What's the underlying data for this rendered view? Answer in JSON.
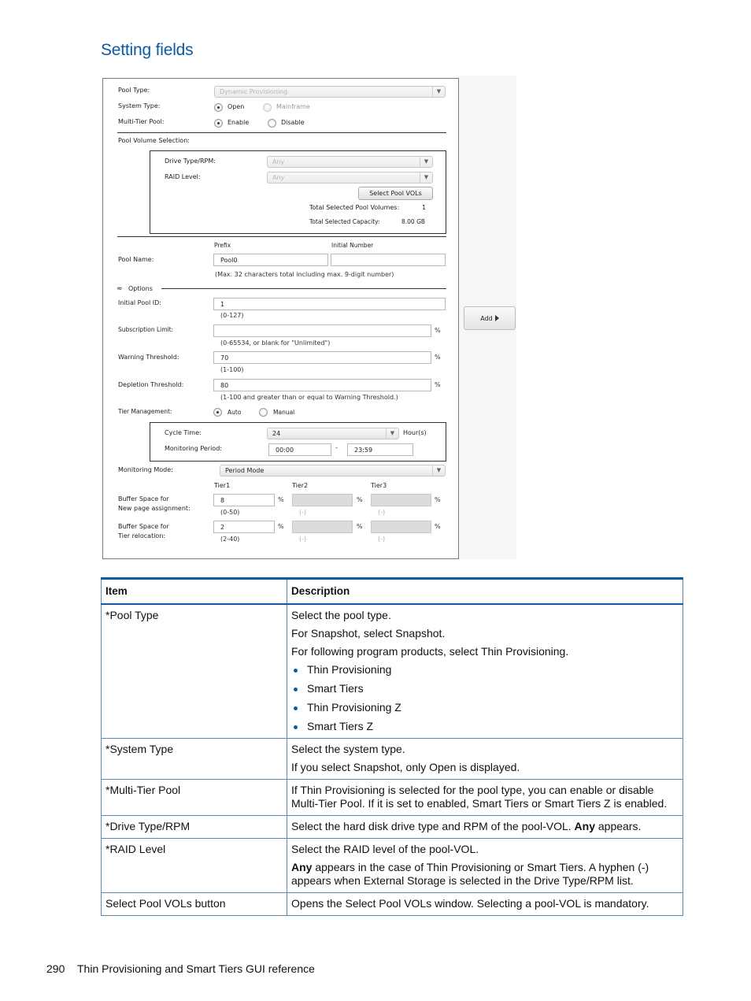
{
  "section_title": "Setting fields",
  "dialog": {
    "pool_type": {
      "label": "Pool Type:",
      "value": "Dynamic Provisioning"
    },
    "system_type": {
      "label": "System Type:",
      "options": [
        "Open",
        "Mainframe"
      ],
      "selected": "Open"
    },
    "multi_tier_pool": {
      "label": "Multi-Tier Pool:",
      "options": [
        "Enable",
        "Disable"
      ],
      "selected": "Enable"
    },
    "pool_volume_selection": {
      "label": "Pool Volume Selection:",
      "drive_type": {
        "label": "Drive Type/RPM:",
        "value": "Any"
      },
      "raid_level": {
        "label": "RAID Level:",
        "value": "Any"
      },
      "select_button": "Select Pool VOLs",
      "total_volumes_label": "Total Selected Pool Volumes:",
      "total_volumes_value": "1",
      "total_capacity_label": "Total Selected Capacity:",
      "total_capacity_value": "8.00 GB"
    },
    "pool_name": {
      "label": "Pool Name:",
      "prefix_header": "Prefix",
      "initial_number_header": "Initial Number",
      "prefix_value": "Pool0",
      "initial_number_value": "",
      "hint": "(Max. 32 characters total including max. 9-digit number)"
    },
    "options_label": "Options",
    "initial_pool_id": {
      "label": "Initial Pool ID:",
      "value": "1",
      "hint": "(0-127)"
    },
    "subscription_limit": {
      "label": "Subscription Limit:",
      "value": "",
      "unit": "%",
      "hint": "(0-65534, or blank for \"Unlimited\")"
    },
    "warning_threshold": {
      "label": "Warning Threshold:",
      "value": "70",
      "unit": "%",
      "hint": "(1-100)"
    },
    "depletion_threshold": {
      "label": "Depletion Threshold:",
      "value": "80",
      "unit": "%",
      "hint": "(1-100 and greater than or equal to Warning Threshold.)"
    },
    "tier_management": {
      "label": "Tier Management:",
      "options": [
        "Auto",
        "Manual"
      ],
      "selected": "Auto"
    },
    "cycle_time": {
      "label": "Cycle Time:",
      "value": "24",
      "unit": "Hour(s)"
    },
    "monitoring_period": {
      "label": "Monitoring Period:",
      "start": "00:00",
      "separator": "-",
      "end": "23:59"
    },
    "monitoring_mode": {
      "label": "Monitoring Mode:",
      "value": "Period Mode"
    },
    "tiers": {
      "headers": [
        "Tier1",
        "Tier2",
        "Tier3"
      ],
      "buffer_new_page": {
        "label_line1": "Buffer Space for",
        "label_line2": "New page assignment:",
        "values": [
          "8",
          "",
          ""
        ],
        "hints": [
          "(0-50)",
          "(-)",
          "(-)"
        ],
        "unit": "%"
      },
      "buffer_relocation": {
        "label_line1": "Buffer Space for",
        "label_line2": "Tier relocation:",
        "values": [
          "2",
          "",
          ""
        ],
        "hints": [
          "(2-40)",
          "(-)",
          "(-)"
        ],
        "unit": "%"
      }
    },
    "add_button": "Add"
  },
  "table": {
    "headers": [
      "Item",
      "Description"
    ],
    "rows": [
      {
        "item": "*Pool Type",
        "desc": [
          "Select the pool type.",
          "For Snapshot, select Snapshot.",
          "For following program products, select Thin Provisioning."
        ],
        "bullets": [
          "Thin Provisioning",
          "Smart Tiers",
          "Thin Provisioning Z",
          "Smart Tiers Z"
        ]
      },
      {
        "item": "*System Type",
        "desc": [
          "Select the system type.",
          "If you select Snapshot, only Open is displayed."
        ]
      },
      {
        "item": "*Multi-Tier Pool",
        "desc": [
          "If Thin Provisioning is selected for the pool type, you can enable or disable Multi-Tier Pool. If it is set to enabled, Smart Tiers or Smart Tiers Z is enabled."
        ]
      },
      {
        "item": "*Drive Type/RPM",
        "desc_pre": "Select the hard disk drive type and RPM of the pool-VOL. ",
        "desc_bold": "Any",
        "desc_post": " appears."
      },
      {
        "item": "*RAID Level",
        "desc": [
          "Select the RAID level of the pool-VOL."
        ],
        "desc2_bold": "Any",
        "desc2_post": " appears in the case of Thin Provisioning or Smart Tiers. A hyphen (-) appears when External Storage is selected in the Drive Type/RPM list."
      },
      {
        "item": "Select Pool VOLs button",
        "desc": [
          "Opens the Select Pool VOLs window. Selecting a pool-VOL is mandatory."
        ]
      }
    ]
  },
  "footer": {
    "page_number": "290",
    "chapter": "Thin Provisioning and Smart Tiers GUI reference"
  }
}
